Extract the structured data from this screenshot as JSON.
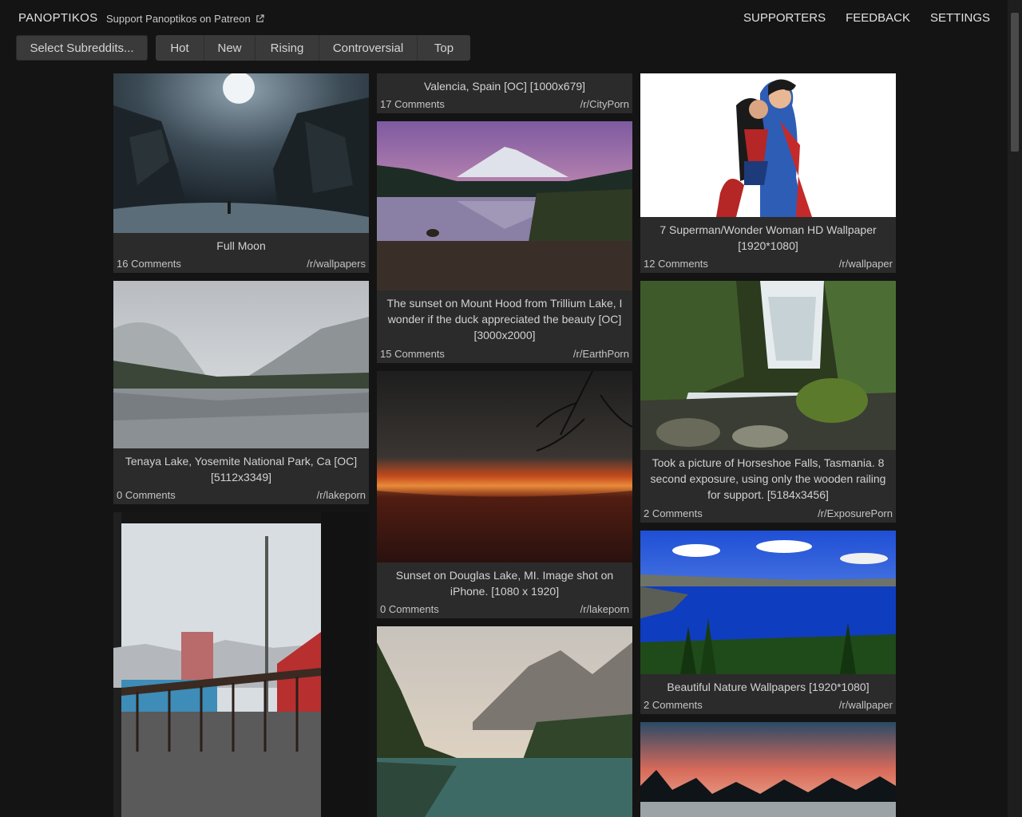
{
  "header": {
    "brand": "PANOPTIKOS",
    "patreon_link": "Support Panoptikos on Patreon",
    "nav": [
      "SUPPORTERS",
      "FEEDBACK",
      "SETTINGS"
    ]
  },
  "toolbar": {
    "select_subreddits": "Select Subreddits...",
    "sort_options": [
      "Hot",
      "New",
      "Rising",
      "Controversial",
      "Top"
    ]
  },
  "posts": [
    {
      "title": "Full Moon",
      "comments": "16 Comments",
      "subreddit": "/r/wallpapers"
    },
    {
      "title": "Tenaya Lake, Yosemite National Park, Ca [OC] [5112x3349]",
      "comments": "0 Comments",
      "subreddit": "/r/lakeporn"
    },
    {
      "title": "Valencia, Spain [OC] [1000x679]",
      "comments": "17 Comments",
      "subreddit": "/r/CityPorn"
    },
    {
      "title": "The sunset on Mount Hood from Trillium Lake, I wonder if the duck appreciated the beauty [OC][3000x2000]",
      "comments": "15 Comments",
      "subreddit": "/r/EarthPorn"
    },
    {
      "title": "Sunset on Douglas Lake, MI. Image shot on iPhone. [1080 x 1920]",
      "comments": "0 Comments",
      "subreddit": "/r/lakeporn"
    },
    {
      "title": "7 Superman/Wonder Woman HD Wallpaper [1920*1080]",
      "comments": "12 Comments",
      "subreddit": "/r/wallpaper"
    },
    {
      "title": "Took a picture of Horseshoe Falls, Tasmania. 8 second exposure, using only the wooden railing for support. [5184x3456]",
      "comments": "2 Comments",
      "subreddit": "/r/ExposurePorn"
    },
    {
      "title": "Beautiful Nature Wallpapers [1920*1080]",
      "comments": "2 Comments",
      "subreddit": "/r/wallpaper"
    }
  ]
}
